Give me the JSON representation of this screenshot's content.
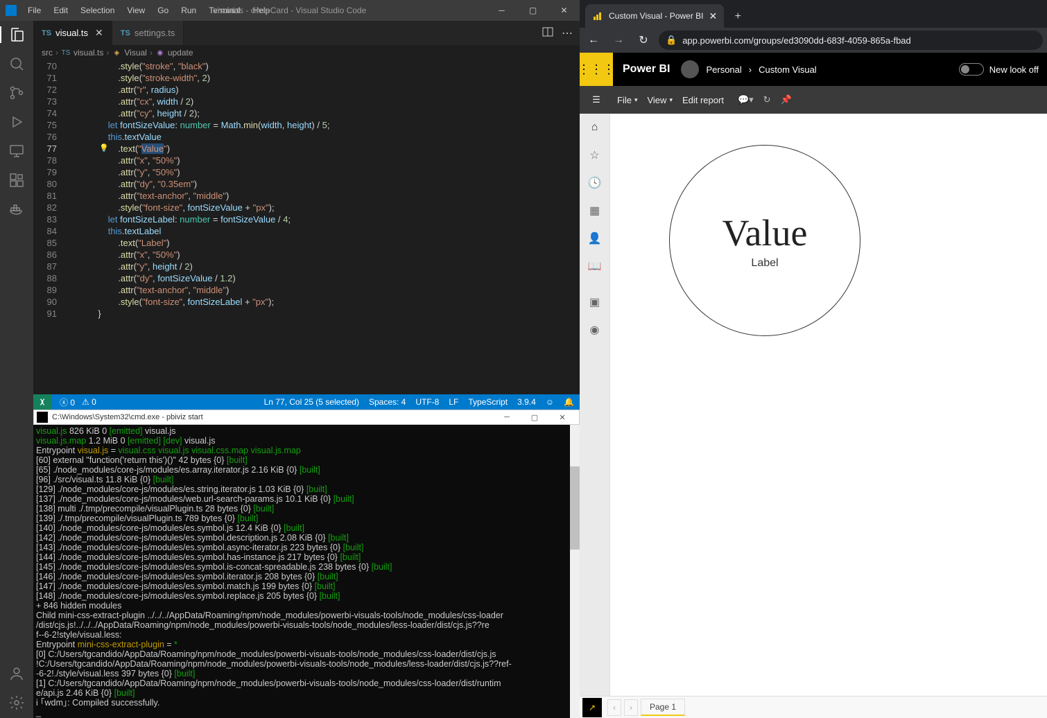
{
  "vscode": {
    "title": "visual.ts - circleCard - Visual Studio Code",
    "menu": [
      "File",
      "Edit",
      "Selection",
      "View",
      "Go",
      "Run",
      "Terminal",
      "Help"
    ],
    "tabs": [
      {
        "name": "visual.ts",
        "icon": "TS",
        "active": true,
        "close": true
      },
      {
        "name": "settings.ts",
        "icon": "TS",
        "active": false,
        "close": false
      }
    ],
    "breadcrumb": {
      "folder": "src",
      "file": "visual.ts",
      "class": "Visual",
      "method": "update",
      "chev": "›"
    },
    "code": [
      {
        "n": 70,
        "seg": [
          [
            "pun",
            "                    ."
          ],
          [
            "fn",
            "style"
          ],
          [
            "pun",
            "("
          ],
          [
            "str",
            "\"stroke\""
          ],
          [
            "pun",
            ", "
          ],
          [
            "str",
            "\"black\""
          ],
          [
            "pun",
            ")"
          ]
        ]
      },
      {
        "n": 71,
        "seg": [
          [
            "pun",
            "                    ."
          ],
          [
            "fn",
            "style"
          ],
          [
            "pun",
            "("
          ],
          [
            "str",
            "\"stroke-width\""
          ],
          [
            "pun",
            ", "
          ],
          [
            "num",
            "2"
          ],
          [
            "pun",
            ")"
          ]
        ]
      },
      {
        "n": 72,
        "seg": [
          [
            "pun",
            "                    ."
          ],
          [
            "fn",
            "attr"
          ],
          [
            "pun",
            "("
          ],
          [
            "str",
            "\"r\""
          ],
          [
            "pun",
            ", "
          ],
          [
            "id",
            "radius"
          ],
          [
            "pun",
            ")"
          ]
        ]
      },
      {
        "n": 73,
        "seg": [
          [
            "pun",
            "                    ."
          ],
          [
            "fn",
            "attr"
          ],
          [
            "pun",
            "("
          ],
          [
            "str",
            "\"cx\""
          ],
          [
            "pun",
            ", "
          ],
          [
            "id",
            "width"
          ],
          [
            "pun",
            " / "
          ],
          [
            "num",
            "2"
          ],
          [
            "pun",
            ")"
          ]
        ]
      },
      {
        "n": 74,
        "seg": [
          [
            "pun",
            "                    ."
          ],
          [
            "fn",
            "attr"
          ],
          [
            "pun",
            "("
          ],
          [
            "str",
            "\"cy\""
          ],
          [
            "pun",
            ", "
          ],
          [
            "id",
            "height"
          ],
          [
            "pun",
            " / "
          ],
          [
            "num",
            "2"
          ],
          [
            "pun",
            ");"
          ]
        ]
      },
      {
        "n": 75,
        "seg": [
          [
            "pun",
            "                "
          ],
          [
            "kw",
            "let"
          ],
          [
            "pun",
            " "
          ],
          [
            "id",
            "fontSizeValue"
          ],
          [
            "pun",
            ": "
          ],
          [
            "type",
            "number"
          ],
          [
            "pun",
            " = "
          ],
          [
            "id",
            "Math"
          ],
          [
            "pun",
            "."
          ],
          [
            "fn",
            "min"
          ],
          [
            "pun",
            "("
          ],
          [
            "id",
            "width"
          ],
          [
            "pun",
            ", "
          ],
          [
            "id",
            "height"
          ],
          [
            "pun",
            ") / "
          ],
          [
            "num",
            "5"
          ],
          [
            "pun",
            ";"
          ]
        ]
      },
      {
        "n": 76,
        "seg": [
          [
            "pun",
            "                "
          ],
          [
            "kw",
            "this"
          ],
          [
            "pun",
            "."
          ],
          [
            "id",
            "textValue"
          ]
        ]
      },
      {
        "n": 77,
        "glyph": "💡",
        "seg": [
          [
            "pun",
            "                    ."
          ],
          [
            "fn",
            "text"
          ],
          [
            "pun",
            "("
          ],
          [
            "str",
            "\""
          ],
          [
            "strsel",
            "Value"
          ],
          [
            "str",
            "\""
          ],
          [
            "pun",
            ")"
          ]
        ]
      },
      {
        "n": 78,
        "seg": [
          [
            "pun",
            "                    ."
          ],
          [
            "fn",
            "attr"
          ],
          [
            "pun",
            "("
          ],
          [
            "str",
            "\"x\""
          ],
          [
            "pun",
            ", "
          ],
          [
            "str",
            "\"50%\""
          ],
          [
            "pun",
            ")"
          ]
        ]
      },
      {
        "n": 79,
        "seg": [
          [
            "pun",
            "                    ."
          ],
          [
            "fn",
            "attr"
          ],
          [
            "pun",
            "("
          ],
          [
            "str",
            "\"y\""
          ],
          [
            "pun",
            ", "
          ],
          [
            "str",
            "\"50%\""
          ],
          [
            "pun",
            ")"
          ]
        ]
      },
      {
        "n": 80,
        "seg": [
          [
            "pun",
            "                    ."
          ],
          [
            "fn",
            "attr"
          ],
          [
            "pun",
            "("
          ],
          [
            "str",
            "\"dy\""
          ],
          [
            "pun",
            ", "
          ],
          [
            "str",
            "\"0.35em\""
          ],
          [
            "pun",
            ")"
          ]
        ]
      },
      {
        "n": 81,
        "seg": [
          [
            "pun",
            "                    ."
          ],
          [
            "fn",
            "attr"
          ],
          [
            "pun",
            "("
          ],
          [
            "str",
            "\"text-anchor\""
          ],
          [
            "pun",
            ", "
          ],
          [
            "str",
            "\"middle\""
          ],
          [
            "pun",
            ")"
          ]
        ]
      },
      {
        "n": 82,
        "seg": [
          [
            "pun",
            "                    ."
          ],
          [
            "fn",
            "style"
          ],
          [
            "pun",
            "("
          ],
          [
            "str",
            "\"font-size\""
          ],
          [
            "pun",
            ", "
          ],
          [
            "id",
            "fontSizeValue"
          ],
          [
            "pun",
            " + "
          ],
          [
            "str",
            "\"px\""
          ],
          [
            "pun",
            ");"
          ]
        ]
      },
      {
        "n": 83,
        "seg": [
          [
            "pun",
            "                "
          ],
          [
            "kw",
            "let"
          ],
          [
            "pun",
            " "
          ],
          [
            "id",
            "fontSizeLabel"
          ],
          [
            "pun",
            ": "
          ],
          [
            "type",
            "number"
          ],
          [
            "pun",
            " = "
          ],
          [
            "id",
            "fontSizeValue"
          ],
          [
            "pun",
            " / "
          ],
          [
            "num",
            "4"
          ],
          [
            "pun",
            ";"
          ]
        ]
      },
      {
        "n": 84,
        "seg": [
          [
            "pun",
            "                "
          ],
          [
            "kw",
            "this"
          ],
          [
            "pun",
            "."
          ],
          [
            "id",
            "textLabel"
          ]
        ]
      },
      {
        "n": 85,
        "seg": [
          [
            "pun",
            "                    ."
          ],
          [
            "fn",
            "text"
          ],
          [
            "pun",
            "("
          ],
          [
            "str",
            "\"Label\""
          ],
          [
            "pun",
            ")"
          ]
        ]
      },
      {
        "n": 86,
        "seg": [
          [
            "pun",
            "                    ."
          ],
          [
            "fn",
            "attr"
          ],
          [
            "pun",
            "("
          ],
          [
            "str",
            "\"x\""
          ],
          [
            "pun",
            ", "
          ],
          [
            "str",
            "\"50%\""
          ],
          [
            "pun",
            ")"
          ]
        ]
      },
      {
        "n": 87,
        "seg": [
          [
            "pun",
            "                    ."
          ],
          [
            "fn",
            "attr"
          ],
          [
            "pun",
            "("
          ],
          [
            "str",
            "\"y\""
          ],
          [
            "pun",
            ", "
          ],
          [
            "id",
            "height"
          ],
          [
            "pun",
            " / "
          ],
          [
            "num",
            "2"
          ],
          [
            "pun",
            ")"
          ]
        ]
      },
      {
        "n": 88,
        "seg": [
          [
            "pun",
            "                    ."
          ],
          [
            "fn",
            "attr"
          ],
          [
            "pun",
            "("
          ],
          [
            "str",
            "\"dy\""
          ],
          [
            "pun",
            ", "
          ],
          [
            "id",
            "fontSizeValue"
          ],
          [
            "pun",
            " / "
          ],
          [
            "num",
            "1.2"
          ],
          [
            "pun",
            ")"
          ]
        ]
      },
      {
        "n": 89,
        "seg": [
          [
            "pun",
            "                    ."
          ],
          [
            "fn",
            "attr"
          ],
          [
            "pun",
            "("
          ],
          [
            "str",
            "\"text-anchor\""
          ],
          [
            "pun",
            ", "
          ],
          [
            "str",
            "\"middle\""
          ],
          [
            "pun",
            ")"
          ]
        ]
      },
      {
        "n": 90,
        "seg": [
          [
            "pun",
            "                    ."
          ],
          [
            "fn",
            "style"
          ],
          [
            "pun",
            "("
          ],
          [
            "str",
            "\"font-size\""
          ],
          [
            "pun",
            ", "
          ],
          [
            "id",
            "fontSizeLabel"
          ],
          [
            "pun",
            " + "
          ],
          [
            "str",
            "\"px\""
          ],
          [
            "pun",
            ");"
          ]
        ]
      },
      {
        "n": 91,
        "seg": [
          [
            "pun",
            "            }"
          ]
        ]
      }
    ],
    "status": {
      "errors": "0",
      "warnings": "0",
      "lncol": "Ln 77, Col 25 (5 selected)",
      "spaces": "Spaces: 4",
      "encoding": "UTF-8",
      "eol": "LF",
      "lang": "TypeScript",
      "tsver": "3.9.4"
    }
  },
  "cmd": {
    "title": "C:\\Windows\\System32\\cmd.exe - pbiviz  start",
    "lines": [
      [
        [
          "pun",
          "                         "
        ],
        [
          "g",
          "visual.js"
        ],
        [
          "pun",
          "    826 KiB       0  "
        ],
        [
          "g",
          "[emitted]"
        ],
        [
          "pun",
          "         visual.js"
        ]
      ],
      [
        [
          "pun",
          "                     "
        ],
        [
          "g",
          "visual.js.map"
        ],
        [
          "pun",
          "    1.2 MiB       0  "
        ],
        [
          "g",
          "[emitted] [dev]"
        ],
        [
          "pun",
          "   visual.js"
        ]
      ],
      [
        [
          "pun",
          "Entrypoint "
        ],
        [
          "y",
          "visual.js"
        ],
        [
          "pun",
          " = "
        ],
        [
          "g",
          "visual.css visual.js visual.css.map visual.js.map"
        ]
      ],
      [
        [
          "pun",
          " [60] external \"function('return this')()\" 42 bytes {0} "
        ],
        [
          "g",
          "[built]"
        ]
      ],
      [
        [
          "pun",
          " [65] ./node_modules/core-js/modules/es.array.iterator.js 2.16 KiB {0} "
        ],
        [
          "g",
          "[built]"
        ]
      ],
      [
        [
          "pun",
          " [96] ./src/visual.ts 11.8 KiB {0} "
        ],
        [
          "g",
          "[built]"
        ]
      ],
      [
        [
          "pun",
          "[129] ./node_modules/core-js/modules/es.string.iterator.js 1.03 KiB {0} "
        ],
        [
          "g",
          "[built]"
        ]
      ],
      [
        [
          "pun",
          "[137] ./node_modules/core-js/modules/web.url-search-params.js 10.1 KiB {0} "
        ],
        [
          "g",
          "[built]"
        ]
      ],
      [
        [
          "pun",
          "[138] multi ./.tmp/precompile/visualPlugin.ts 28 bytes {0} "
        ],
        [
          "g",
          "[built]"
        ]
      ],
      [
        [
          "pun",
          "[139] ./.tmp/precompile/visualPlugin.ts 789 bytes {0} "
        ],
        [
          "g",
          "[built]"
        ]
      ],
      [
        [
          "pun",
          "[140] ./node_modules/core-js/modules/es.symbol.js 12.4 KiB {0} "
        ],
        [
          "g",
          "[built]"
        ]
      ],
      [
        [
          "pun",
          "[142] ./node_modules/core-js/modules/es.symbol.description.js 2.08 KiB {0} "
        ],
        [
          "g",
          "[built]"
        ]
      ],
      [
        [
          "pun",
          "[143] ./node_modules/core-js/modules/es.symbol.async-iterator.js 223 bytes {0} "
        ],
        [
          "g",
          "[built]"
        ]
      ],
      [
        [
          "pun",
          "[144] ./node_modules/core-js/modules/es.symbol.has-instance.js 217 bytes {0} "
        ],
        [
          "g",
          "[built]"
        ]
      ],
      [
        [
          "pun",
          "[145] ./node_modules/core-js/modules/es.symbol.is-concat-spreadable.js 238 bytes {0} "
        ],
        [
          "g",
          "[built]"
        ]
      ],
      [
        [
          "pun",
          "[146] ./node_modules/core-js/modules/es.symbol.iterator.js 208 bytes {0} "
        ],
        [
          "g",
          "[built]"
        ]
      ],
      [
        [
          "pun",
          "[147] ./node_modules/core-js/modules/es.symbol.match.js 199 bytes {0} "
        ],
        [
          "g",
          "[built]"
        ]
      ],
      [
        [
          "pun",
          "[148] ./node_modules/core-js/modules/es.symbol.replace.js 205 bytes {0} "
        ],
        [
          "g",
          "[built]"
        ]
      ],
      [
        [
          "pun",
          "    + 846 hidden modules"
        ]
      ],
      [
        [
          "pun",
          "Child mini-css-extract-plugin ../../../AppData/Roaming/npm/node_modules/powerbi-visuals-tools/node_modules/css-loader"
        ]
      ],
      [
        [
          "pun",
          "/dist/cjs.js!../../../AppData/Roaming/npm/node_modules/powerbi-visuals-tools/node_modules/less-loader/dist/cjs.js??re"
        ]
      ],
      [
        [
          "pun",
          "f--6-2!style/visual.less:"
        ]
      ],
      [
        [
          "pun",
          "    Entrypoint "
        ],
        [
          "y",
          "mini-css-extract-plugin"
        ],
        [
          "pun",
          " = "
        ],
        [
          "g",
          "*"
        ]
      ],
      [
        [
          "pun",
          "    [0] C:/Users/tgcandido/AppData/Roaming/npm/node_modules/powerbi-visuals-tools/node_modules/css-loader/dist/cjs.js"
        ]
      ],
      [
        [
          "pun",
          "!C:/Users/tgcandido/AppData/Roaming/npm/node_modules/powerbi-visuals-tools/node_modules/less-loader/dist/cjs.js??ref-"
        ]
      ],
      [
        [
          "pun",
          "-6-2!./style/visual.less 397 bytes {0} "
        ],
        [
          "g",
          "[built]"
        ]
      ],
      [
        [
          "pun",
          "    [1] C:/Users/tgcandido/AppData/Roaming/npm/node_modules/powerbi-visuals-tools/node_modules/css-loader/dist/runtim"
        ]
      ],
      [
        [
          "pun",
          "e/api.js 2.46 KiB {0} "
        ],
        [
          "g",
          "[built]"
        ]
      ],
      [
        [
          "pun",
          "i ｢wdm｣: Compiled successfully."
        ]
      ],
      [
        [
          "pun",
          "_"
        ]
      ]
    ]
  },
  "browser": {
    "tab_title": "Custom Visual - Power BI",
    "url": "app.powerbi.com/groups/ed3090dd-683f-4059-865a-fbad"
  },
  "powerbi": {
    "logo": "Power BI",
    "crumb": {
      "workspace": "Personal",
      "report": "Custom Visual",
      "chev": "›"
    },
    "newlook": "New look off",
    "cmd": {
      "file": "File",
      "view": "View",
      "edit": "Edit report"
    },
    "visual": {
      "value": "Value",
      "label": "Label"
    },
    "footer": {
      "page": "Page 1"
    }
  }
}
